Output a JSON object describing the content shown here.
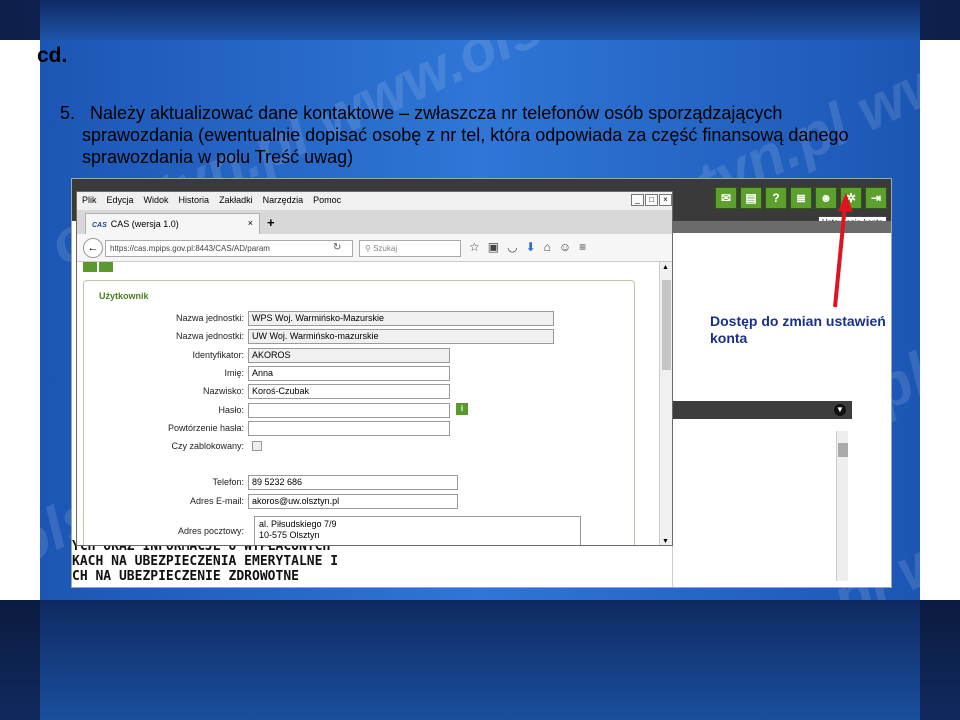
{
  "slide": {
    "heading": "cd.",
    "point_number": "5.",
    "point_line1": "Należy aktualizować dane kontaktowe – zwłaszcza nr telefonów osób sporządzających",
    "point_line2": "sprawozdania (ewentualnie dopisać osobę z nr tel, która odpowiada za część finansową danego",
    "point_line3": "sprawozdania w polu Treść uwag)",
    "watermark": "olsztyn.pl www.olsztyn.pl"
  },
  "annotation": {
    "line1": "Dostęp do zmian ustawień",
    "line2": "konta",
    "color": "#1a2f8c",
    "arrow_color": "#e0141e"
  },
  "app_toolbar": {
    "icons": [
      "mail-icon",
      "document-icon",
      "help-icon",
      "report-icon",
      "user-icon",
      "settings-gear-icon",
      "exit-icon"
    ],
    "tooltip": "Ustawienia konta",
    "accent": "#5da02d"
  },
  "background_text": {
    "line1": "YCH ORAZ INFORMACJE O WYPŁACONYCH",
    "line2": "KACH NA UBEZPIECZENIA EMERYTALNE I",
    "line3": "CH NA UBEZPIECZENIE ZDROWOTNE"
  },
  "browser": {
    "menu": [
      "Plik",
      "Edycja",
      "Widok",
      "Historia",
      "Zakładki",
      "Narzędzia",
      "Pomoc"
    ],
    "tab_logo": "CAS",
    "tab_title": "CAS (wersja 1.0)",
    "tab_close": "×",
    "new_tab": "+",
    "url": "https://cas.mpips.gov.pl:8443/CAS/AD/param",
    "search_placeholder": "Szukaj"
  },
  "form": {
    "legend": "Użytkownik",
    "fields": [
      {
        "label": "Nazwa jednostki:",
        "value": "WPS Woj. Warmińsko-Mazurskie"
      },
      {
        "label": "Nazwa jednostki:",
        "value": "UW Woj. Warmińsko-mazurskie"
      },
      {
        "label": "Identyfikator:",
        "value": "AKOROS"
      },
      {
        "label": "Imię:",
        "value": "Anna"
      },
      {
        "label": "Nazwisko:",
        "value": "Koroś-Czubak"
      },
      {
        "label": "Hasło:",
        "value": ""
      },
      {
        "label": "Powtórzenie hasła:",
        "value": ""
      },
      {
        "label": "Czy zablokowany:",
        "value": ""
      },
      {
        "label": "Telefon:",
        "value": "89 5232 686"
      },
      {
        "label": "Adres E-mail:",
        "value": "akoros@uw.olsztyn.pl"
      },
      {
        "label": "Adres pocztowy:",
        "value": "al. Piłsudskiego 7/9",
        "value2": "10-575 Olsztyn"
      }
    ]
  }
}
